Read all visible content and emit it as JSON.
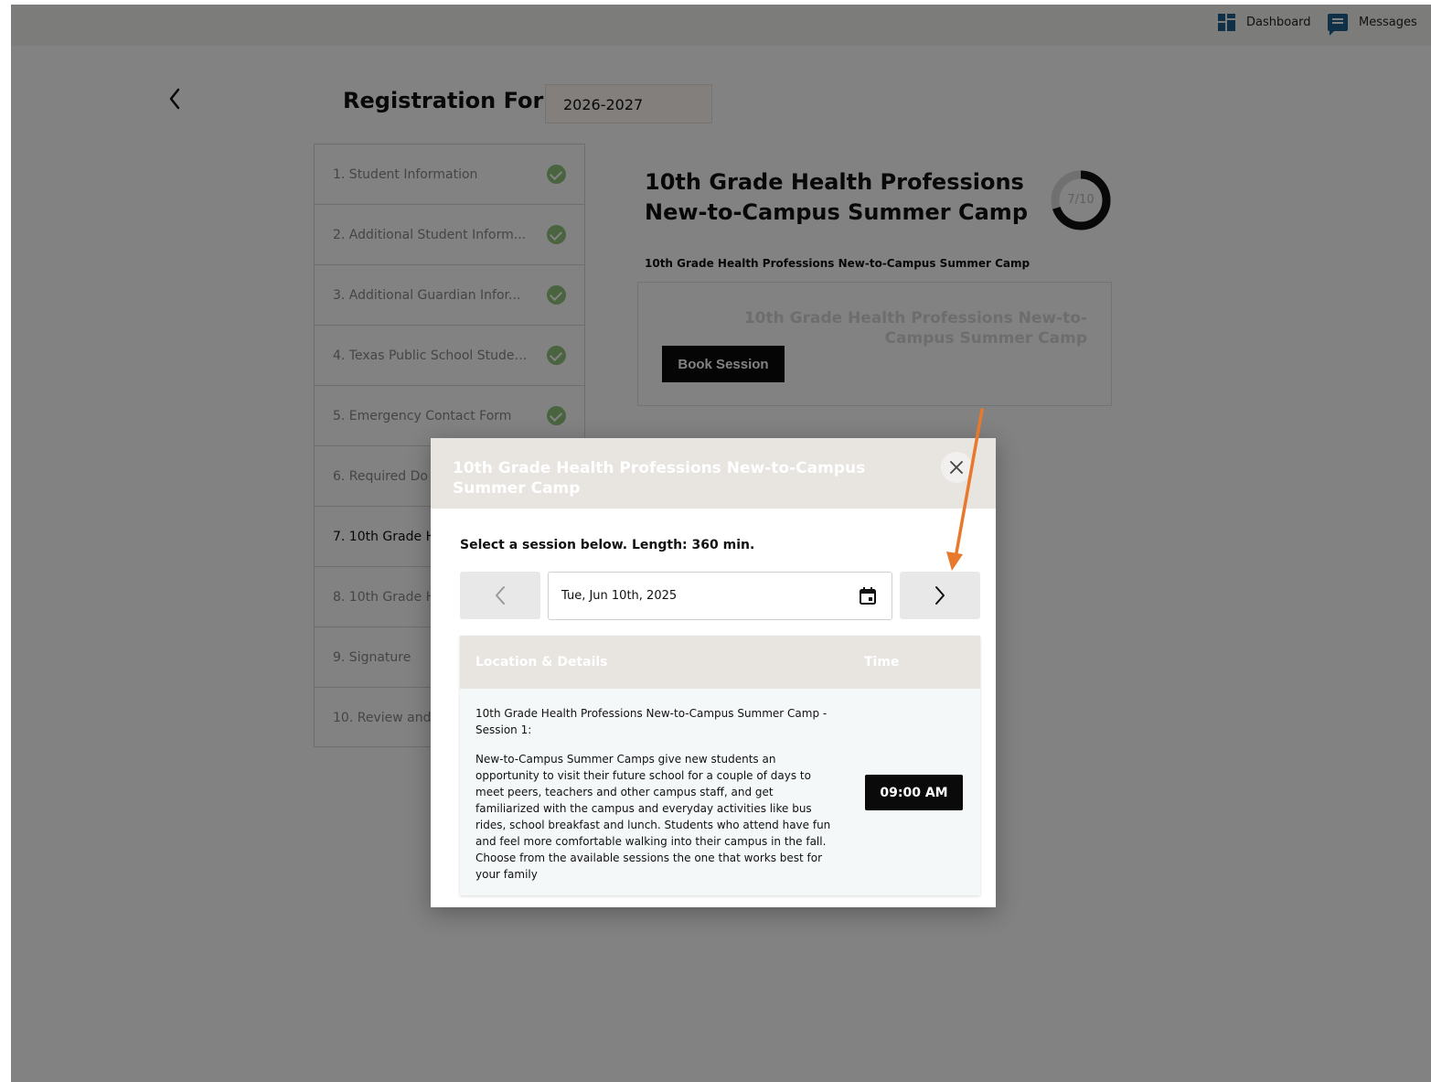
{
  "topbar": {
    "dashboard_label": "Dashboard",
    "messages_label": "Messages",
    "icon_color": "#1f5f8b"
  },
  "form": {
    "title": "Registration Form:",
    "year": "2026-2027"
  },
  "steps": [
    {
      "label": "1. Student Information",
      "complete": true
    },
    {
      "label": "2. Additional Student Inform...",
      "complete": true
    },
    {
      "label": "3. Additional Guardian Infor...",
      "complete": true
    },
    {
      "label": "4. Texas Public School Studen...",
      "complete": true
    },
    {
      "label": "5. Emergency Contact Form",
      "complete": true
    },
    {
      "label": "6. Required Do",
      "complete": false
    },
    {
      "label": "7. 10th Grade H",
      "complete": false
    },
    {
      "label": "8. 10th Grade H",
      "complete": false
    },
    {
      "label": "9. Signature",
      "complete": false
    },
    {
      "label": "10. Review and",
      "complete": false
    }
  ],
  "main": {
    "title": "10th Grade Health Professions New-to-Campus Summer Camp",
    "progress_text": "7/10",
    "progress_fraction": 0.7,
    "subtitle": "10th Grade Health Professions New-to-Campus Summer Camp",
    "card_title": "10th Grade Health Professions New-to-Campus Summer Camp",
    "book_label": "Book Session"
  },
  "modal": {
    "title": "10th Grade Health Professions New-to-Campus Summer Camp",
    "prompt": "Select a session below. Length: 360 min.",
    "date_value": "Tue, Jun 10th, 2025",
    "columns": {
      "location": "Location & Details",
      "time": "Time"
    },
    "session": {
      "name": "10th Grade Health Professions New-to-Campus Summer Camp - Session 1:",
      "description": "New-to-Campus Summer Camps give new students an opportunity to visit their future school for a couple of days to meet peers, teachers and other campus staff, and get familiarized with the campus and everyday activities like bus rides, school breakfast and lunch. Students who attend have fun and feel more comfortable walking into their campus in the fall. Choose from the available sessions the one that works best for your family",
      "time": "09:00 AM"
    }
  },
  "colors": {
    "annotation_arrow": "#e8782c",
    "check_green": "#8fc47a"
  }
}
